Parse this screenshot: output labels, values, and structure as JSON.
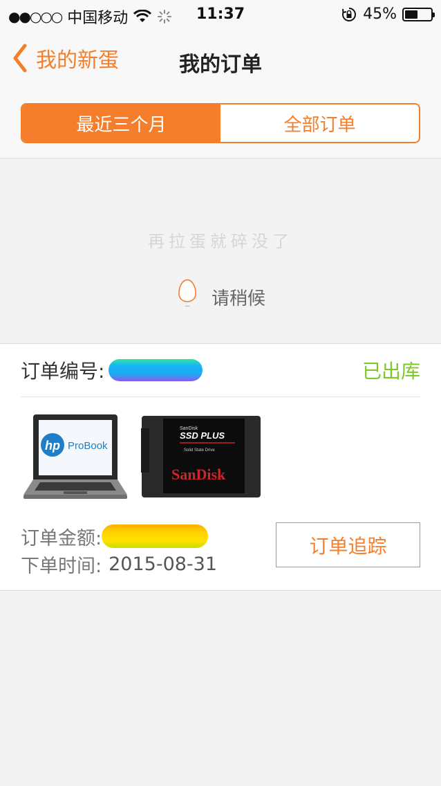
{
  "status_bar": {
    "signal_dots": "●●○○○",
    "carrier": "中国移动",
    "time": "11:37",
    "battery_percent": "45%",
    "battery_level": 0.45,
    "icons": [
      "wifi-icon",
      "loading-spinner-icon",
      "rotation-lock-icon",
      "battery-icon"
    ]
  },
  "nav": {
    "back_label": "我的新蛋",
    "title": "我的订单"
  },
  "segments": {
    "recent": "最近三个月",
    "all": "全部订单",
    "selected": "recent"
  },
  "pull_refresh": {
    "hint": "再拉蛋就碎没了",
    "loading": "请稍候"
  },
  "order": {
    "number_label": "订单编号:",
    "status": "已出库",
    "products": [
      {
        "name": "HP ProBook",
        "brand": "hp",
        "model": "ProBook"
      },
      {
        "name": "SanDisk SSD PLUS",
        "brand": "SanDisk",
        "small_brand": "SanDisk",
        "model": "SSD PLUS",
        "subtitle": "Solid State Drive"
      }
    ],
    "amount_label": "订单金额:",
    "time_label": "下单时间:",
    "time_value": "2015-08-31",
    "track_button": "订单追踪"
  },
  "colors": {
    "accent": "#f47e2b",
    "status_green": "#7cc829"
  }
}
